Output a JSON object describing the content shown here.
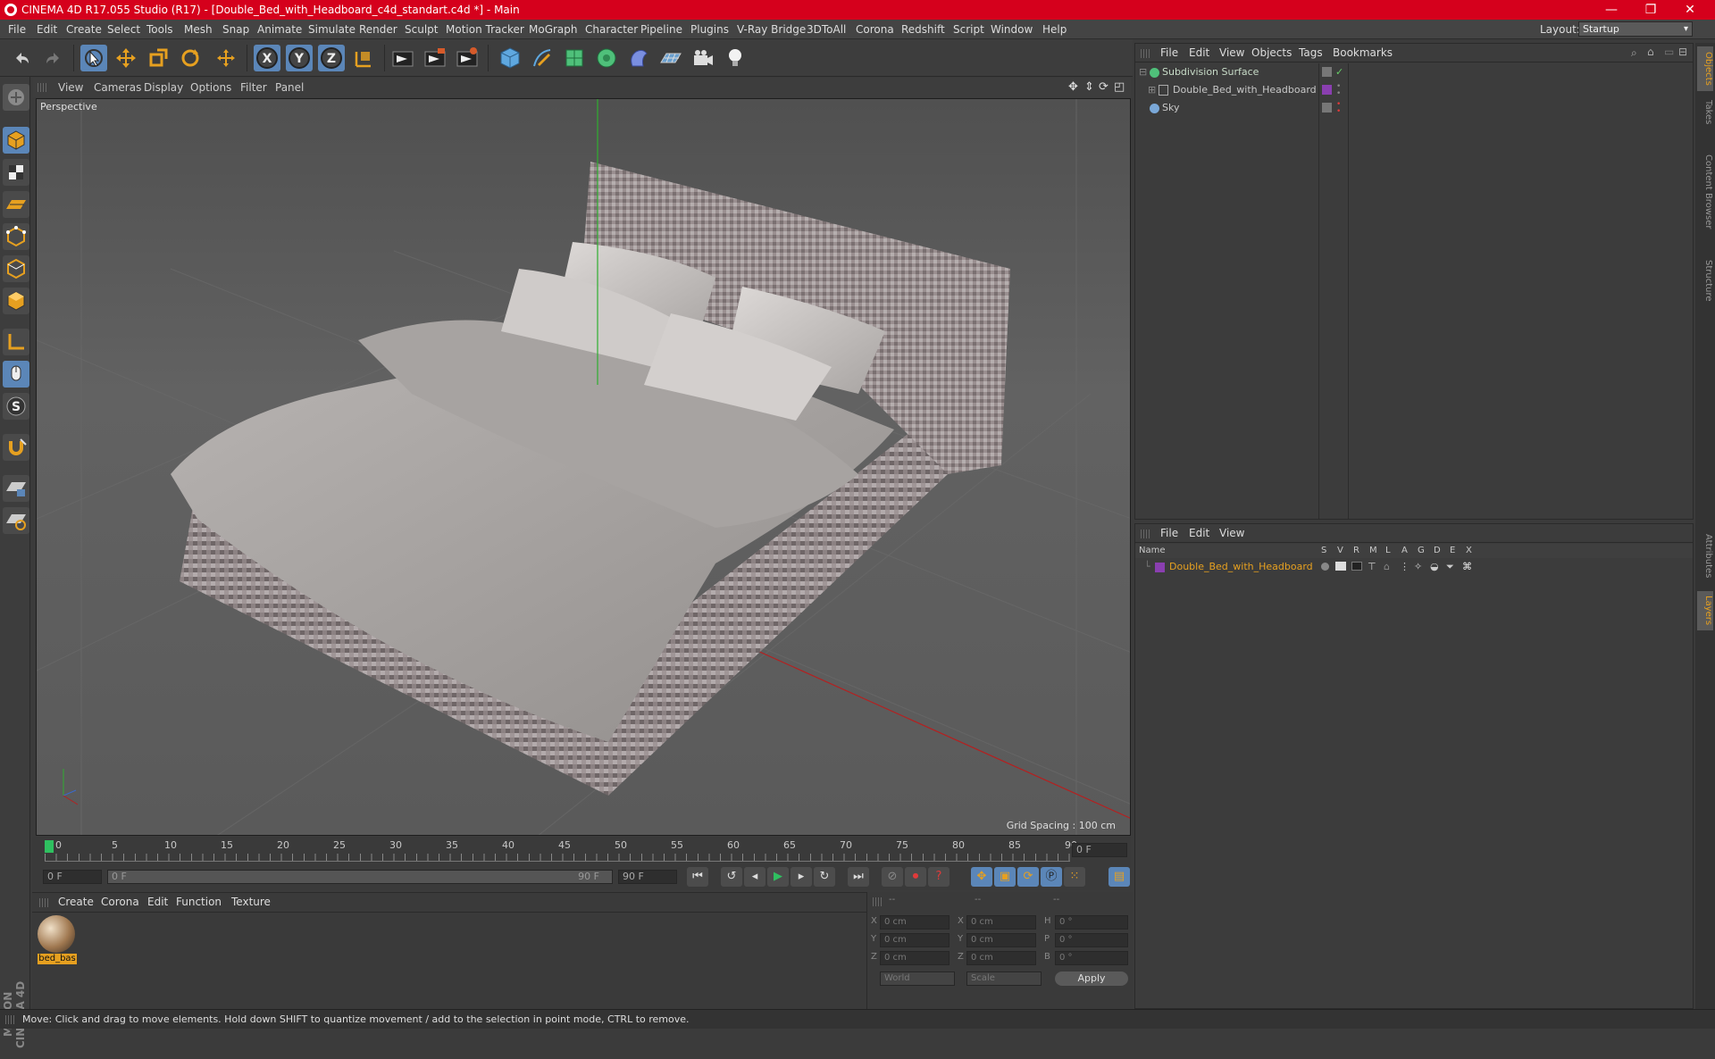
{
  "window": {
    "title": "CINEMA 4D R17.055 Studio (R17) - [Double_Bed_with_Headboard_c4d_standart.c4d *] - Main",
    "minimize": "—",
    "maximize": "❐",
    "close": "✕"
  },
  "menubar": {
    "items": [
      "File",
      "Edit",
      "Create",
      "Select",
      "Tools",
      "Mesh",
      "Snap",
      "Animate",
      "Simulate",
      "Render",
      "Sculpt",
      "Motion Tracker",
      "MoGraph",
      "Character",
      "Pipeline",
      "Plugins",
      "V-Ray Bridge",
      "3DToAll",
      "Corona",
      "Redshift",
      "Script",
      "Window",
      "Help"
    ],
    "layout_label": "Layout:",
    "layout_value": "Startup"
  },
  "toolbar": {
    "icons": [
      "undo-icon",
      "redo-icon",
      "live-select-icon",
      "move-icon",
      "scale-icon",
      "rotate-icon",
      "last-tool-icon",
      "x-axis-icon",
      "y-axis-icon",
      "z-axis-icon",
      "coordinate-system-icon",
      "render-view-icon",
      "render-picture-viewer-icon",
      "edit-render-settings-icon",
      "cube-icon",
      "pen-icon",
      "subdivision-icon",
      "mograph-cloner-icon",
      "deformer-icon",
      "floor-icon",
      "camera-icon",
      "light-icon"
    ],
    "axis_x": "X",
    "axis_y": "Y",
    "axis_z": "Z"
  },
  "viewport": {
    "menu": [
      "View",
      "Cameras",
      "Display",
      "Options",
      "Filter",
      "Panel"
    ],
    "label": "Perspective",
    "grid_spacing": "Grid Spacing : 100 cm"
  },
  "timeline": {
    "ticks": [
      "0",
      "5",
      "10",
      "15",
      "20",
      "25",
      "30",
      "35",
      "40",
      "45",
      "50",
      "55",
      "60",
      "65",
      "70",
      "75",
      "80",
      "85",
      "90"
    ],
    "current_frame": "0 F",
    "start_frame": "0 F",
    "range_start": "0 F",
    "range_end": "90 F",
    "end_frame": "90 F"
  },
  "material_panel": {
    "menu": [
      "Create",
      "Corona",
      "Edit",
      "Function",
      "Texture"
    ],
    "material_name": "bed_bas"
  },
  "coord_panel": {
    "header": [
      "--",
      "--",
      "--"
    ],
    "rows": [
      {
        "a": "X",
        "av": "0 cm",
        "b": "X",
        "bv": "0 cm",
        "c": "H",
        "cv": "0 °"
      },
      {
        "a": "Y",
        "av": "0 cm",
        "b": "Y",
        "bv": "0 cm",
        "c": "P",
        "cv": "0 °"
      },
      {
        "a": "Z",
        "av": "0 cm",
        "b": "Z",
        "bv": "0 cm",
        "c": "B",
        "cv": "0 °"
      }
    ],
    "world": "World",
    "scale": "Scale",
    "apply": "Apply"
  },
  "object_manager": {
    "menu": [
      "File",
      "Edit",
      "View",
      "Objects",
      "Tags",
      "Bookmarks"
    ],
    "objects": [
      {
        "name": "Subdivision Surface",
        "color": "#9dc49d"
      },
      {
        "name": "Double_Bed_with_Headboard",
        "color": "#c8c8c8"
      },
      {
        "name": "Sky",
        "color": "#c8c8c8"
      }
    ]
  },
  "layer_manager": {
    "menu": [
      "File",
      "Edit",
      "View"
    ],
    "columns": [
      "Name",
      "S",
      "V",
      "R",
      "M",
      "L",
      "A",
      "G",
      "D",
      "E",
      "X"
    ],
    "layers": [
      {
        "name": "Double_Bed_with_Headboard",
        "color": "#8a3fb0"
      }
    ]
  },
  "right_tabs": [
    "Objects",
    "Takes",
    "Content Browser",
    "Structure",
    "Attributes",
    "Layers"
  ],
  "maxon_logo": "MAXON CINEMA 4D",
  "status": "Move: Click and drag to move elements. Hold down SHIFT to quantize movement / add to the selection in point mode, CTRL to remove."
}
